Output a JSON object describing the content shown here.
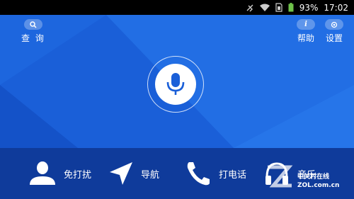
{
  "status_bar": {
    "battery": "93%",
    "time": "17:02",
    "icons": [
      "mute-icon",
      "wifi-icon",
      "sim-icon",
      "battery-icon"
    ]
  },
  "top": {
    "search_label": "查 询",
    "help_label": "帮助",
    "settings_label": "设置"
  },
  "mic": {
    "icon": "microphone-icon"
  },
  "bottom": {
    "items": [
      {
        "label": "免打扰",
        "icon": "person-icon"
      },
      {
        "label": "导航",
        "icon": "navigation-arrow-icon"
      },
      {
        "label": "打电话",
        "icon": "phone-icon"
      },
      {
        "label": "音乐",
        "icon": "headphones-icon"
      }
    ]
  },
  "watermark": {
    "line1": "中关村在线",
    "line2": "ZOL.com.cn"
  },
  "colors": {
    "background": "#1a5fd8",
    "bottom_bar": "#0f3b9b",
    "mic_icon": "#1a5fd8"
  }
}
